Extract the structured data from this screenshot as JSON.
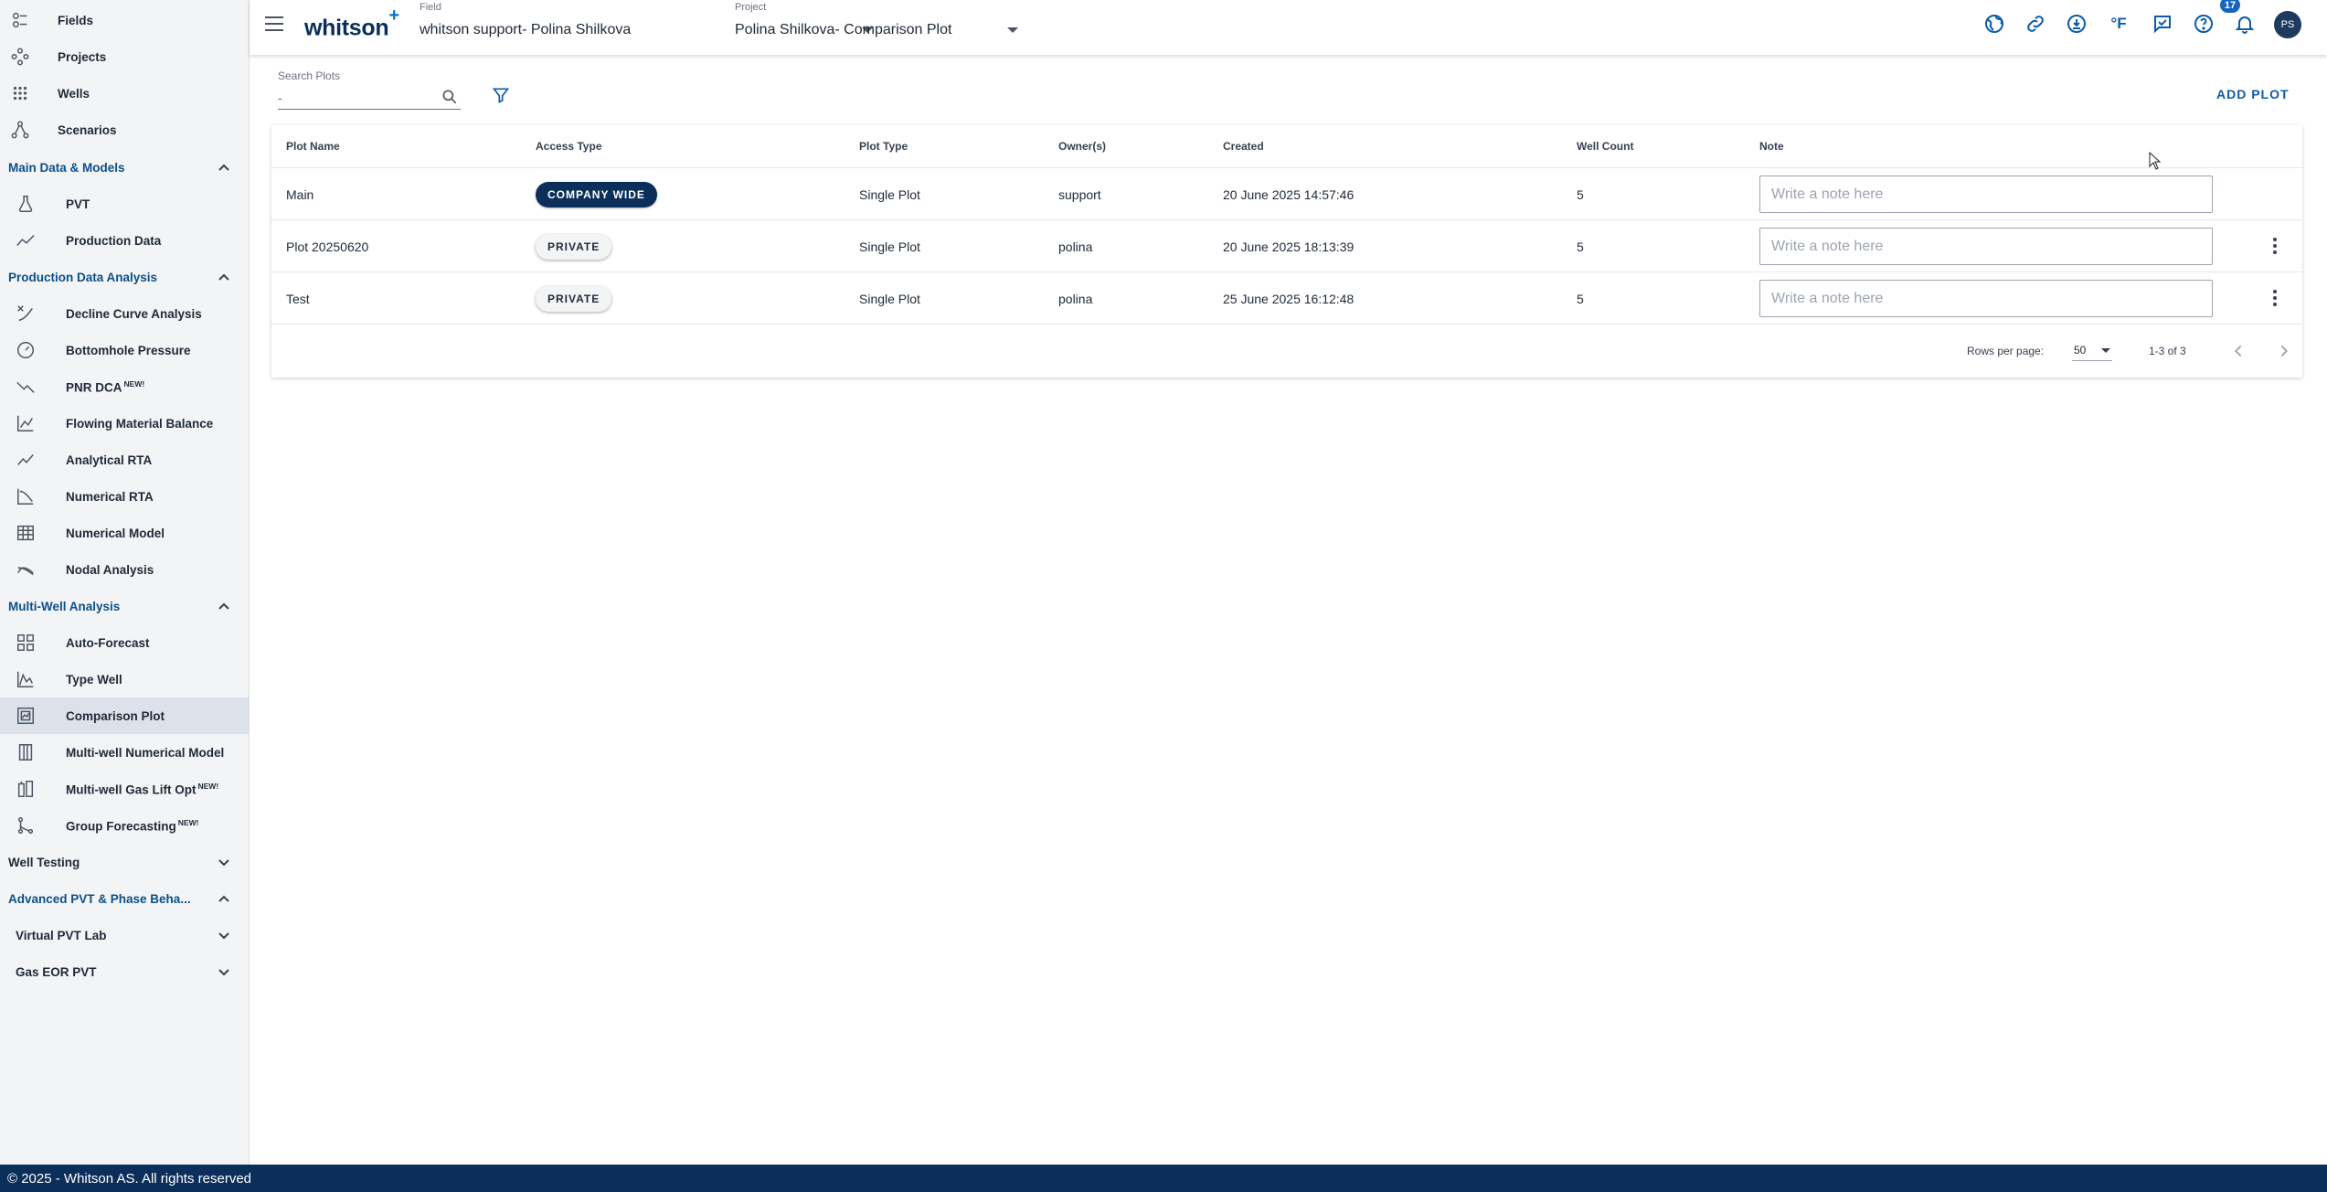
{
  "sidebar": {
    "top_items": [
      {
        "label": "Fields",
        "icon": "fields-icon"
      },
      {
        "label": "Projects",
        "icon": "projects-icon"
      },
      {
        "label": "Wells",
        "icon": "wells-icon"
      },
      {
        "label": "Scenarios",
        "icon": "scenarios-icon"
      }
    ],
    "sections": {
      "main_data": "Main Data & Models",
      "production_analysis": "Production Data Analysis",
      "multi_well": "Multi-Well Analysis",
      "well_testing": "Well Testing",
      "advanced_pvt": "Advanced PVT & Phase Beha...",
      "virtual_pvt": "Virtual PVT Lab",
      "gas_eor": "Gas EOR PVT"
    },
    "main_data_items": [
      {
        "label": "PVT"
      },
      {
        "label": "Production Data"
      }
    ],
    "production_items": [
      {
        "label": "Decline Curve Analysis"
      },
      {
        "label": "Bottomhole Pressure"
      },
      {
        "label": "PNR DCA",
        "sup": "NEW!"
      },
      {
        "label": "Flowing Material Balance"
      },
      {
        "label": "Analytical RTA"
      },
      {
        "label": "Numerical RTA"
      },
      {
        "label": "Numerical Model"
      },
      {
        "label": "Nodal Analysis"
      }
    ],
    "multi_well_items": [
      {
        "label": "Auto-Forecast"
      },
      {
        "label": "Type Well"
      },
      {
        "label": "Comparison Plot"
      },
      {
        "label": "Multi-well Numerical Model"
      },
      {
        "label": "Multi-well Gas Lift Opt",
        "sup": "NEW!"
      },
      {
        "label": "Group Forecasting",
        "sup": "NEW!"
      }
    ]
  },
  "topbar": {
    "logo": "whitson",
    "logo_plus": "+",
    "field_label": "Field",
    "field_value": "whitson support- Polina Shilkova",
    "project_label": "Project",
    "project_value": "Polina Shilkova- Comparison Plot",
    "notification_count": "17",
    "avatar_initials": "PS",
    "temperature_unit": "°F"
  },
  "toolbar": {
    "search_label": "Search Plots",
    "search_value": "-",
    "add_plot_label": "ADD PLOT"
  },
  "table": {
    "columns": [
      "Plot Name",
      "Access Type",
      "Plot Type",
      "Owner(s)",
      "Created",
      "Well Count",
      "Note"
    ],
    "note_placeholder": "Write a note here",
    "rows": [
      {
        "name": "Main",
        "access": "COMPANY WIDE",
        "type": "Single Plot",
        "owner": "support",
        "created": "20 June 2025 14:57:46",
        "wells": "5"
      },
      {
        "name": "Plot 20250620",
        "access": "PRIVATE",
        "type": "Single Plot",
        "owner": "polina",
        "created": "20 June 2025 18:13:39",
        "wells": "5"
      },
      {
        "name": "Test",
        "access": "PRIVATE",
        "type": "Single Plot",
        "owner": "polina",
        "created": "25 June 2025 16:12:48",
        "wells": "5"
      }
    ]
  },
  "pagination": {
    "rows_label": "Rows per page:",
    "rows_value": "50",
    "count": "1-3 of 3"
  },
  "footer": {
    "text": "© 2025 - Whitson AS. All rights reserved"
  }
}
